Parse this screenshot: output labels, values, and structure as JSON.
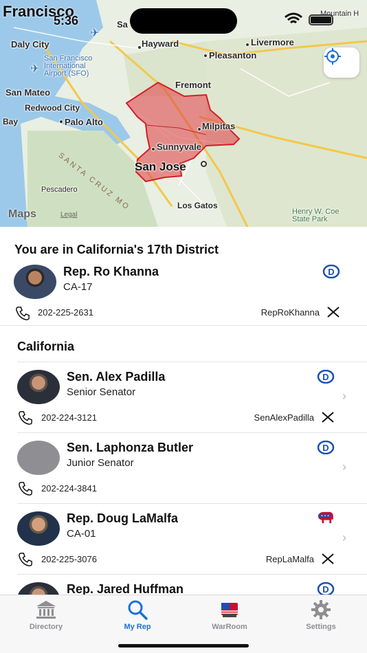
{
  "status_bar": {
    "city": "Francisco",
    "time": "5:36"
  },
  "map": {
    "labels": {
      "daly_city": "Daly City",
      "hayward": "Hayward",
      "livermore": "Livermore",
      "pleasanton": "Pleasanton",
      "sfo": "San Francisco\nInternational\nAirport (SFO)",
      "san_mateo": "San Mateo",
      "redwood_city": "Redwood City",
      "bay": "Bay",
      "palo_alto": "Palo Alto",
      "fremont": "Fremont",
      "milpitas": "Milpitas",
      "sunnyvale": "Sunnyvale",
      "san_jose": "San Jose",
      "pescadero": "Pescadero",
      "los_gatos": "Los Gatos",
      "range": "SANTA CRUZ MO",
      "park": "Henry W. Coe\nState Park",
      "mountain": "Mountain H",
      "sa": "Sa"
    },
    "maps_logo": "Maps",
    "legal": "Legal"
  },
  "district": {
    "title": "You are in California's 17th District",
    "rep": {
      "name": "Rep. Ro Khanna",
      "subtitle": "CA-17",
      "party": "D",
      "phone": "202-225-2631",
      "handle": "RepRoKhanna"
    }
  },
  "state": {
    "title": "California",
    "members": [
      {
        "name": "Sen. Alex Padilla",
        "subtitle": "Senior Senator",
        "party": "D",
        "phone": "202-224-3121",
        "handle": "SenAlexPadilla"
      },
      {
        "name": "Sen. Laphonza Butler",
        "subtitle": "Junior Senator",
        "party": "D",
        "phone": "202-224-3841",
        "handle": ""
      },
      {
        "name": "Rep. Doug LaMalfa",
        "subtitle": "CA-01",
        "party": "R",
        "phone": "202-225-3076",
        "handle": "RepLaMalfa"
      },
      {
        "name": "Rep. Jared Huffman",
        "subtitle": "",
        "party": "D",
        "phone": "",
        "handle": ""
      }
    ]
  },
  "tabs": [
    {
      "label": "Directory",
      "icon": "bank-icon"
    },
    {
      "label": "My Rep",
      "icon": "search-icon"
    },
    {
      "label": "WarRoom",
      "icon": "warroom-icon"
    },
    {
      "label": "Settings",
      "icon": "gear-icon"
    }
  ],
  "colors": {
    "accent": "#1a6fd8",
    "democrat": "#1a4fb5",
    "republican": "#c8102e",
    "district_fill": "#e0474c"
  }
}
